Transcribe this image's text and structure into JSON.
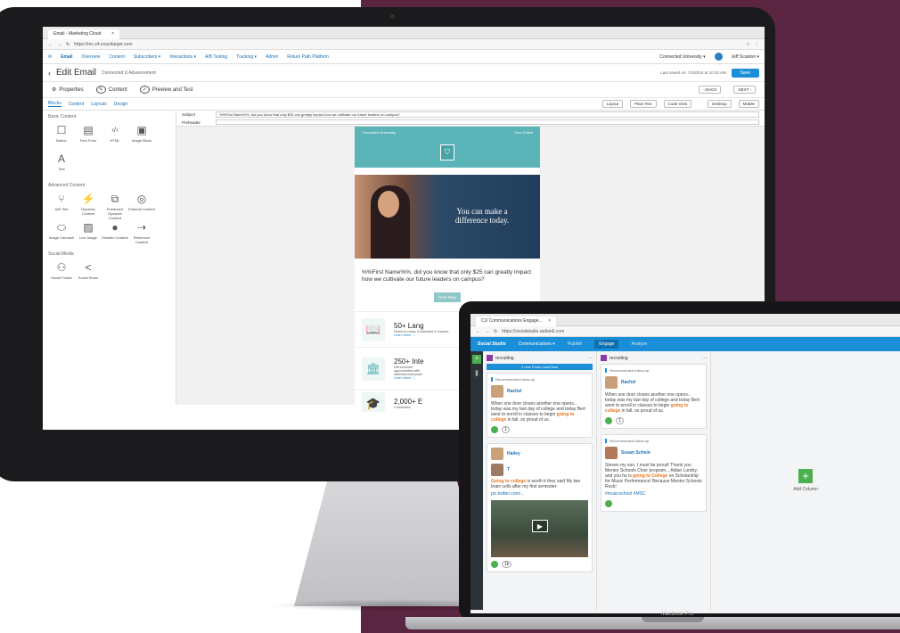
{
  "imac": {
    "browser_tab": "Email - Marketing Cloud",
    "url": "https://mc.s4.exacttarget.com",
    "nav": {
      "app": "Email",
      "items": [
        "Overview",
        "Content",
        "Subscribers ▾",
        "Interactions ▾",
        "A/B Testing",
        "Tracking ▾",
        "Admin",
        "Return Path Platform"
      ],
      "account": "Connected University ▾",
      "user": "Jeff Scanlon ▾"
    },
    "edit": {
      "title": "Edit Email",
      "subtitle": "Connected U Advancement",
      "saved": "Last saved on: 7/4/2016 at 10:23 AM",
      "save_btn": "Save",
      "steps": [
        "Properties",
        "Content",
        "Preview and Test"
      ],
      "back": "‹ BACK",
      "next": "NEXT ›"
    },
    "left_tabs": [
      "Blocks",
      "Content",
      "Layouts",
      "Design"
    ],
    "sections": {
      "basic": "Basic Content",
      "advanced": "Advanced Content",
      "social": "Social Media"
    },
    "basic_blocks": [
      {
        "label": "Button",
        "icon": "button-icon",
        "glyph": "☐"
      },
      {
        "label": "Free Form",
        "icon": "free-form-icon",
        "glyph": "▤"
      },
      {
        "label": "HTML",
        "icon": "html-icon",
        "glyph": "‹/›"
      },
      {
        "label": "Image Block",
        "icon": "image-icon",
        "glyph": "▣"
      },
      {
        "label": "Text",
        "icon": "text-icon",
        "glyph": "A"
      }
    ],
    "advanced_blocks": [
      {
        "label": "A/B Test",
        "icon": "ab-test-icon",
        "glyph": "⑂"
      },
      {
        "label": "Dynamic Content",
        "icon": "dynamic-content-icon",
        "glyph": "⚡"
      },
      {
        "label": "Enhanced Dynamic Content",
        "icon": "enhanced-dynamic-icon",
        "glyph": "⧉"
      },
      {
        "label": "External Content",
        "icon": "external-content-icon",
        "glyph": "◎"
      },
      {
        "label": "Image Carousel",
        "icon": "carousel-icon",
        "glyph": "⬭"
      },
      {
        "label": "Live Image",
        "icon": "live-image-icon",
        "glyph": "▨"
      },
      {
        "label": "Einstein Content",
        "icon": "einstein-icon",
        "glyph": "●"
      },
      {
        "label": "Reference Content",
        "icon": "reference-icon",
        "glyph": "⇢"
      }
    ],
    "social_blocks": [
      {
        "label": "Social Follow",
        "icon": "social-follow-icon",
        "glyph": "⚇"
      },
      {
        "label": "Social Share",
        "icon": "share-icon",
        "glyph": "<"
      }
    ],
    "subject_label": "Subject",
    "subject": "%%First Name%%, did you know that only $25 can greatly impact how we cultivate our future leaders on campus?",
    "preheader_label": "Preheader",
    "toolbar_btns": [
      "Layout",
      "Plain Text",
      "Code View",
      "Desktop",
      "Mobile"
    ],
    "email": {
      "header_left": "Connected University",
      "header_right": "Give Online",
      "hero_text": "You can make a difference today.",
      "body_text": "%%First Name%%, did you know that only $25 can greatly impact how we cultivate our future leaders on campus?",
      "cta": "Give Now",
      "items": [
        {
          "title": "50+ Lang",
          "text": "Home to many Connected U explore.",
          "link": "Learn More →"
        },
        {
          "title": "250+ Inte",
          "text": "Get involved opportunities with interests everyone!",
          "link": "Learn More →"
        },
        {
          "title": "2,000+ E",
          "text": "Connected",
          "link": ""
        }
      ]
    }
  },
  "laptop": {
    "browser_tab": "CU Communications Engage...",
    "url": "https://socialstudio.radian6.com",
    "nav": {
      "app": "Social Studio",
      "items": [
        "Communications ▾",
        "Publish",
        "Engage",
        "Analyze"
      ]
    },
    "columns": [
      {
        "title": "recruiting",
        "new_posts": "2 new Posts  Load Now",
        "cards": [
          {
            "badge": "Recommended follow-up",
            "author": "Rachel",
            "text_before": "When one door closes another one opens... today was my last day of college and today Bert went to enroll in classes to begin ",
            "highlight": "going to college",
            "text_after": " in fall. so proud of us.",
            "count": "1"
          },
          {
            "badge": "",
            "author": "Hailey",
            "author2": "T",
            "text_before": "",
            "highlight": "Going to college",
            "text_after": " is worth it they said My two brain cells after my first semester:",
            "link": "pic.twitter.com/...",
            "count": "1k"
          }
        ]
      },
      {
        "title": "recruiting",
        "new_posts": "",
        "cards": [
          {
            "badge": "Recommended follow-up",
            "author": "Rachel",
            "text_before": "When one door closes another one opens... today was my last day of college and today Bert went to enroll in classes to begin ",
            "highlight": "going to college",
            "text_after": " in fall. so proud of us.",
            "count": "1"
          },
          {
            "badge": "Recommended follow-up",
            "author": "Susan Schein",
            "text_before": "Steven my son, I must be proud! Thank you Mentor Schools Choir program... Aidan Lundry, and you he is ",
            "highlight": "going to College",
            "text_after": " on Scholarship for Music Performance! Because Mentor Schools Rock!",
            "link": "#musicschool #MSC",
            "count": ""
          }
        ]
      }
    ],
    "add_column": "Add Column"
  },
  "laptop_brand": "MacBook Pro",
  "colors": {
    "maroon": "#5a2540",
    "teal": "#5bb4b8",
    "salesforce_blue": "#1a8fd8",
    "orange_highlight": "#e8741b"
  }
}
